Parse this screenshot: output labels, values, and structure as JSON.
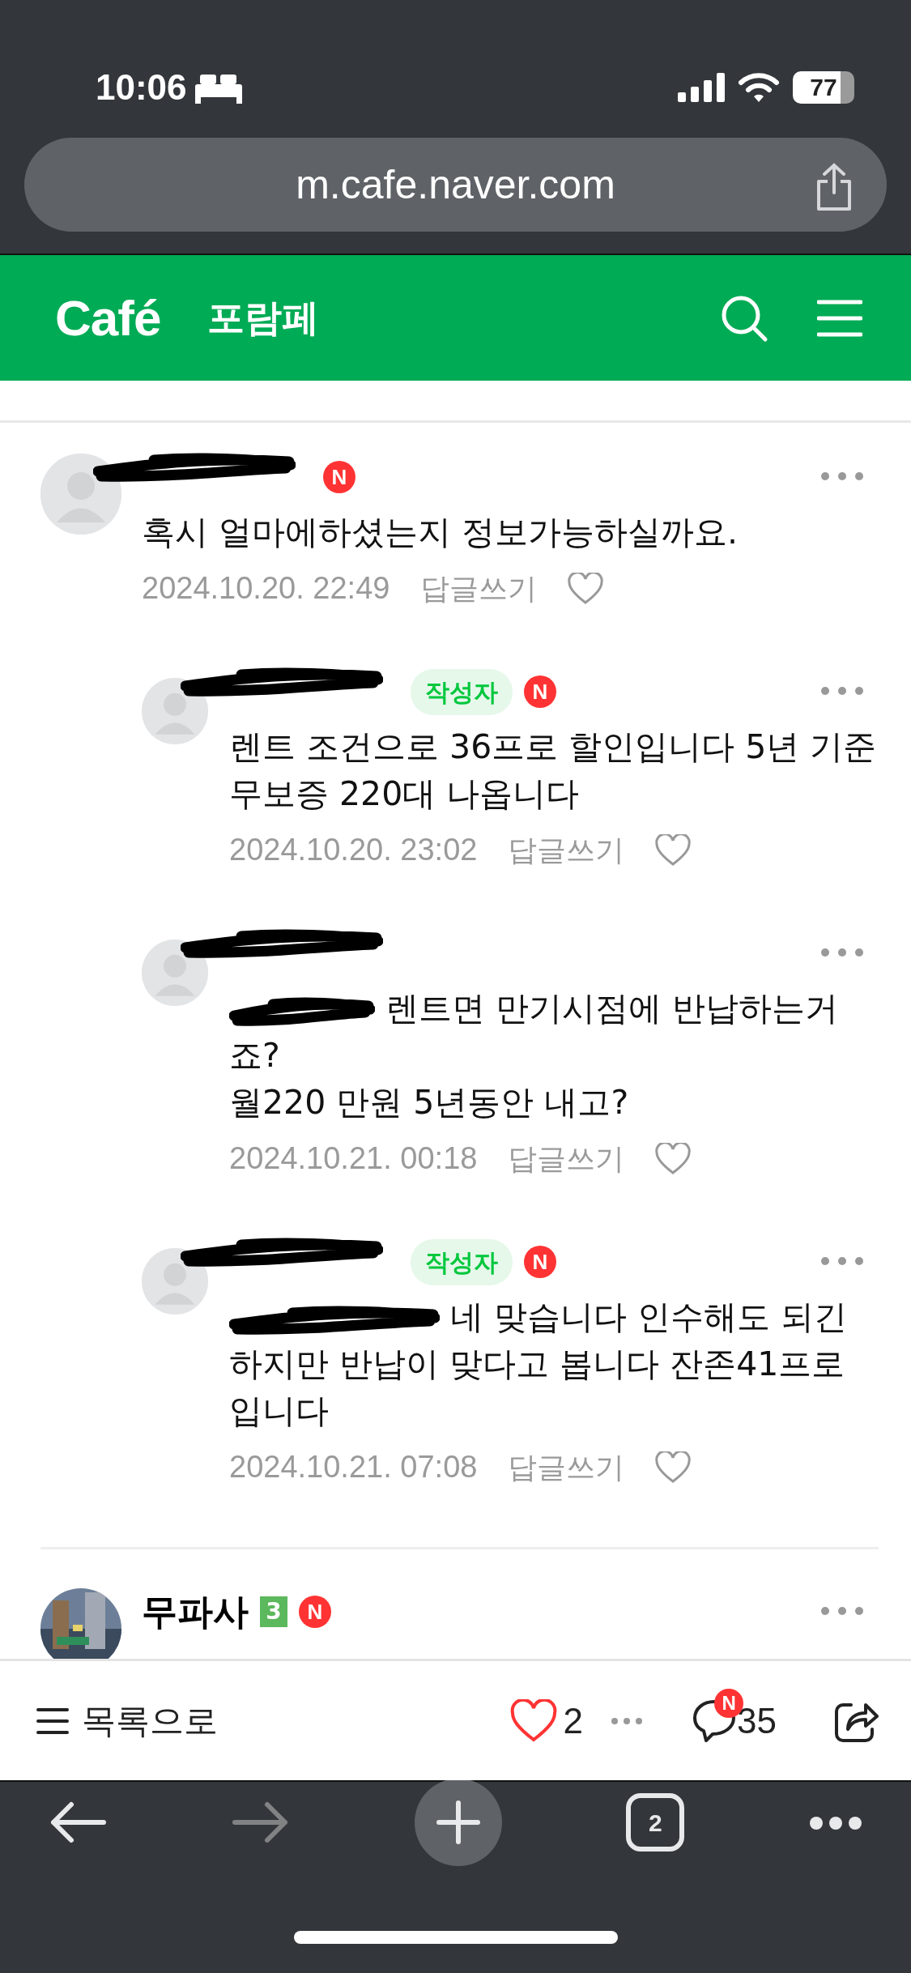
{
  "status_bar": {
    "time": "10:06",
    "battery": "77"
  },
  "browser": {
    "url": "m.cafe.naver.com",
    "tab_count": "2"
  },
  "header": {
    "logo": "Café",
    "title": "포람페"
  },
  "comments": [
    {
      "kind": "comment",
      "author_redacted": true,
      "new_badge": "N",
      "text": "혹시 얼마에하셨는지 정보가능하실까요.",
      "date": "2024.10.20. 22:49",
      "reply": "답글쓰기",
      "liked": false
    },
    {
      "kind": "reply",
      "author_redacted": true,
      "writer_badge": "작성자",
      "new_badge": "N",
      "text": "렌트 조건으로 36프로 할인입니다 5년 기준 무보증 220대 나옵니다",
      "date": "2024.10.20. 23:02",
      "reply": "답글쓰기",
      "liked": false
    },
    {
      "kind": "reply",
      "author_redacted": true,
      "mention_redacted": true,
      "text": "렌트면 만기시점에 반납하는거 죠?\n월220 만원 5년동안 내고?",
      "date": "2024.10.21. 00:18",
      "reply": "답글쓰기",
      "liked": false
    },
    {
      "kind": "reply",
      "author_redacted": true,
      "writer_badge": "작성자",
      "new_badge": "N",
      "mention_redacted": true,
      "text": "네 맞습니다 인수해도 되긴 하지만 반납이 맞다고 봅니다 잔존41프로 입니다",
      "date": "2024.10.21. 07:08",
      "reply": "답글쓰기",
      "liked": false
    },
    {
      "kind": "comment_photo",
      "author": "무파사",
      "level_badge": "3",
      "new_badge": "N"
    }
  ],
  "bottom_bar": {
    "list_label": "목록으로",
    "likes": "2",
    "liked": false,
    "comment_count": "35",
    "comment_new": "N"
  }
}
